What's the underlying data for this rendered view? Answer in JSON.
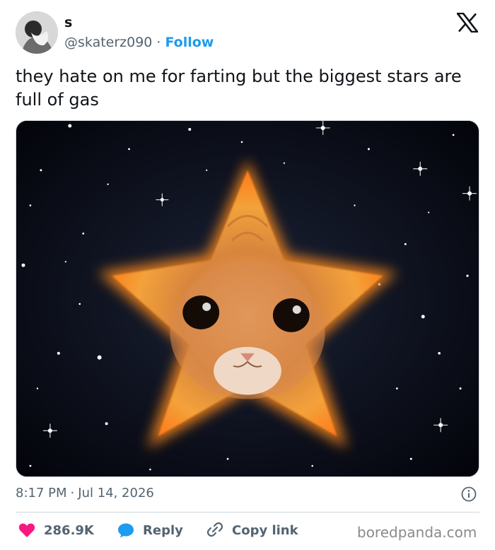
{
  "author": {
    "display_name": "s",
    "handle": "@skaterz090",
    "separator": "·",
    "follow_label": "Follow"
  },
  "tweet": {
    "text": "they hate on me for farting but the biggest stars are full of gas",
    "time": "8:17 PM",
    "separator": "·",
    "date": "Jul 14, 2026"
  },
  "media": {
    "description_icon": "star-shaped-cat-in-space-image"
  },
  "actions": {
    "likes": "286.9K",
    "reply_label": "Reply",
    "copy_link_label": "Copy link"
  },
  "watermark": "boredpanda.com",
  "colors": {
    "accent": "#1d9bf0",
    "like_heart": "#f91880",
    "text_primary": "#0f1419",
    "text_secondary": "#536471",
    "border": "#cfd9de"
  }
}
